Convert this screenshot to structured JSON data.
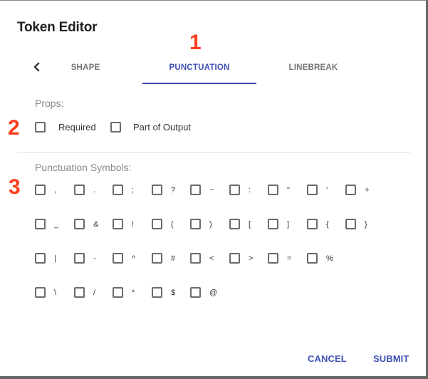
{
  "dialog": {
    "title": "Token Editor"
  },
  "tabs": {
    "back_icon": "chevron-left-icon",
    "items": [
      {
        "label": "SHAPE",
        "active": false
      },
      {
        "label": "PUNCTUATION",
        "active": true
      },
      {
        "label": "LINEBREAK",
        "active": false
      }
    ]
  },
  "annotations": [
    "1",
    "2",
    "3"
  ],
  "props": {
    "label": "Props:",
    "options": [
      {
        "label": "Required",
        "checked": false
      },
      {
        "label": "Part of Output",
        "checked": false
      }
    ]
  },
  "punctuation": {
    "label": "Punctuation Symbols:",
    "rows": [
      [
        ",",
        ".",
        ";",
        "?",
        "~",
        ":",
        "\"",
        "'",
        "+"
      ],
      [
        "_",
        "&",
        "!",
        "(",
        ")",
        "[",
        "]",
        "{",
        "}"
      ],
      [
        "|",
        "-",
        "^",
        "#",
        "<",
        ">",
        "=",
        "%"
      ],
      [
        "\\",
        "/",
        "*",
        "$",
        "@"
      ]
    ]
  },
  "footer": {
    "cancel_label": "CANCEL",
    "submit_label": "SUBMIT"
  },
  "colors": {
    "accent": "#3f51b5",
    "annotation": "#ff3d1f"
  }
}
